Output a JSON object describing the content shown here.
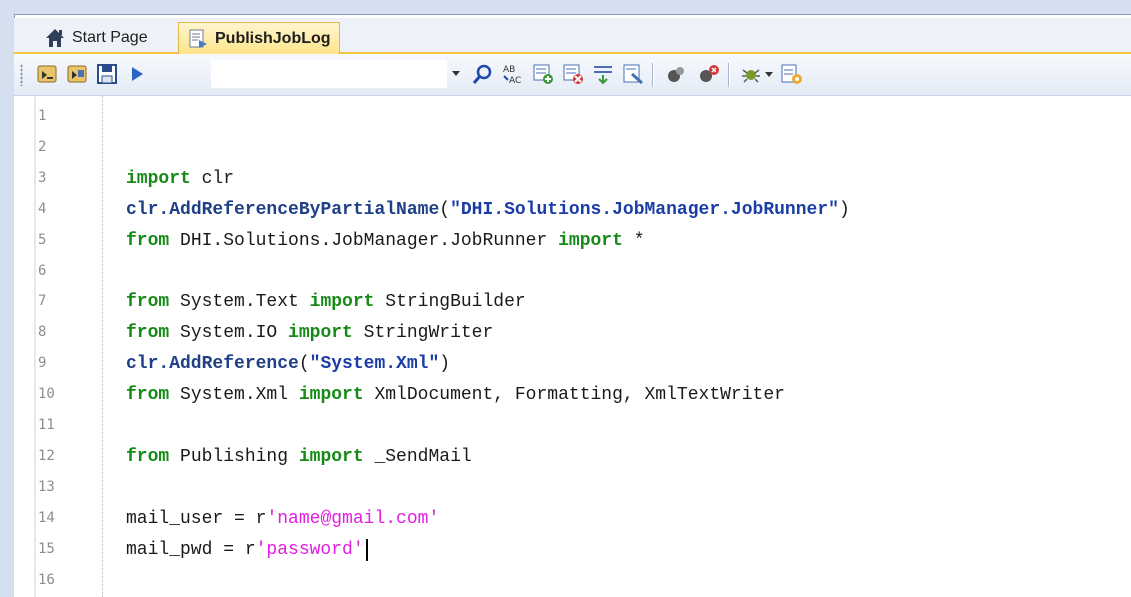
{
  "tabs": [
    {
      "label": "Start Page",
      "icon": "home-icon",
      "active": false
    },
    {
      "label": "PublishJobLog",
      "icon": "script-document-icon",
      "active": true
    }
  ],
  "toolbar": {
    "left_buttons": [
      "open-script-icon",
      "save-script-icon",
      "save-icon",
      "run-icon"
    ],
    "combo_value": "",
    "right_buttons": [
      "find-icon",
      "replace-icon",
      "comment-icon",
      "uncomment-icon",
      "indent-icon",
      "outdent-icon",
      "toggle-breakpoint-icon",
      "clear-breakpoints-icon",
      "debug-icon",
      "tools-icon"
    ]
  },
  "editor": {
    "line_numbers": [
      "1",
      "2",
      "3",
      "4",
      "5",
      "6",
      "7",
      "8",
      "9",
      "10",
      "11",
      "12",
      "13",
      "14",
      "15",
      "16"
    ],
    "lines": [
      {
        "n": 3,
        "segments": [
          {
            "t": "import",
            "c": "kw"
          },
          {
            "t": " clr",
            "c": ""
          }
        ]
      },
      {
        "n": 4,
        "segments": [
          {
            "t": "clr.",
            "c": "fn"
          },
          {
            "t": "AddReferenceByPartialName",
            "c": "fn"
          },
          {
            "t": "(",
            "c": ""
          },
          {
            "t": "\"DHI.Solutions.JobManager.JobRunner\"",
            "c": "str"
          },
          {
            "t": ")",
            "c": ""
          }
        ]
      },
      {
        "n": 5,
        "segments": [
          {
            "t": "from",
            "c": "kw"
          },
          {
            "t": " DHI.Solutions.JobManager.JobRunner ",
            "c": ""
          },
          {
            "t": "import",
            "c": "kw"
          },
          {
            "t": " *",
            "c": ""
          }
        ]
      },
      {
        "n": 7,
        "segments": [
          {
            "t": "from",
            "c": "kw"
          },
          {
            "t": " System.Text ",
            "c": ""
          },
          {
            "t": "import",
            "c": "kw"
          },
          {
            "t": " StringBuilder",
            "c": ""
          }
        ]
      },
      {
        "n": 8,
        "segments": [
          {
            "t": "from",
            "c": "kw"
          },
          {
            "t": " System.IO ",
            "c": ""
          },
          {
            "t": "import",
            "c": "kw"
          },
          {
            "t": " StringWriter",
            "c": ""
          }
        ]
      },
      {
        "n": 9,
        "segments": [
          {
            "t": "clr.AddReference",
            "c": "fn"
          },
          {
            "t": "(",
            "c": ""
          },
          {
            "t": "\"System.Xml\"",
            "c": "str"
          },
          {
            "t": ")",
            "c": ""
          }
        ]
      },
      {
        "n": 10,
        "segments": [
          {
            "t": "from",
            "c": "kw"
          },
          {
            "t": " System.Xml ",
            "c": ""
          },
          {
            "t": "import",
            "c": "kw"
          },
          {
            "t": " XmlDocument, Formatting, XmlTextWriter",
            "c": ""
          }
        ]
      },
      {
        "n": 12,
        "segments": [
          {
            "t": "from",
            "c": "kw"
          },
          {
            "t": " Publishing ",
            "c": ""
          },
          {
            "t": "import",
            "c": "kw"
          },
          {
            "t": " _SendMail",
            "c": ""
          }
        ]
      },
      {
        "n": 14,
        "segments": [
          {
            "t": "mail_user = r",
            "c": ""
          },
          {
            "t": "'name@gmail.com'",
            "c": "pink"
          }
        ]
      },
      {
        "n": 15,
        "segments": [
          {
            "t": "mail_pwd = r",
            "c": ""
          },
          {
            "t": "'password'",
            "c": "pink"
          }
        ],
        "caret": true
      }
    ]
  },
  "colors": {
    "keyword": "#168a17",
    "function": "#1f3f86",
    "string": "#1b3da8",
    "raw_string": "#e31ee3",
    "active_tab": "#ffe48a"
  }
}
